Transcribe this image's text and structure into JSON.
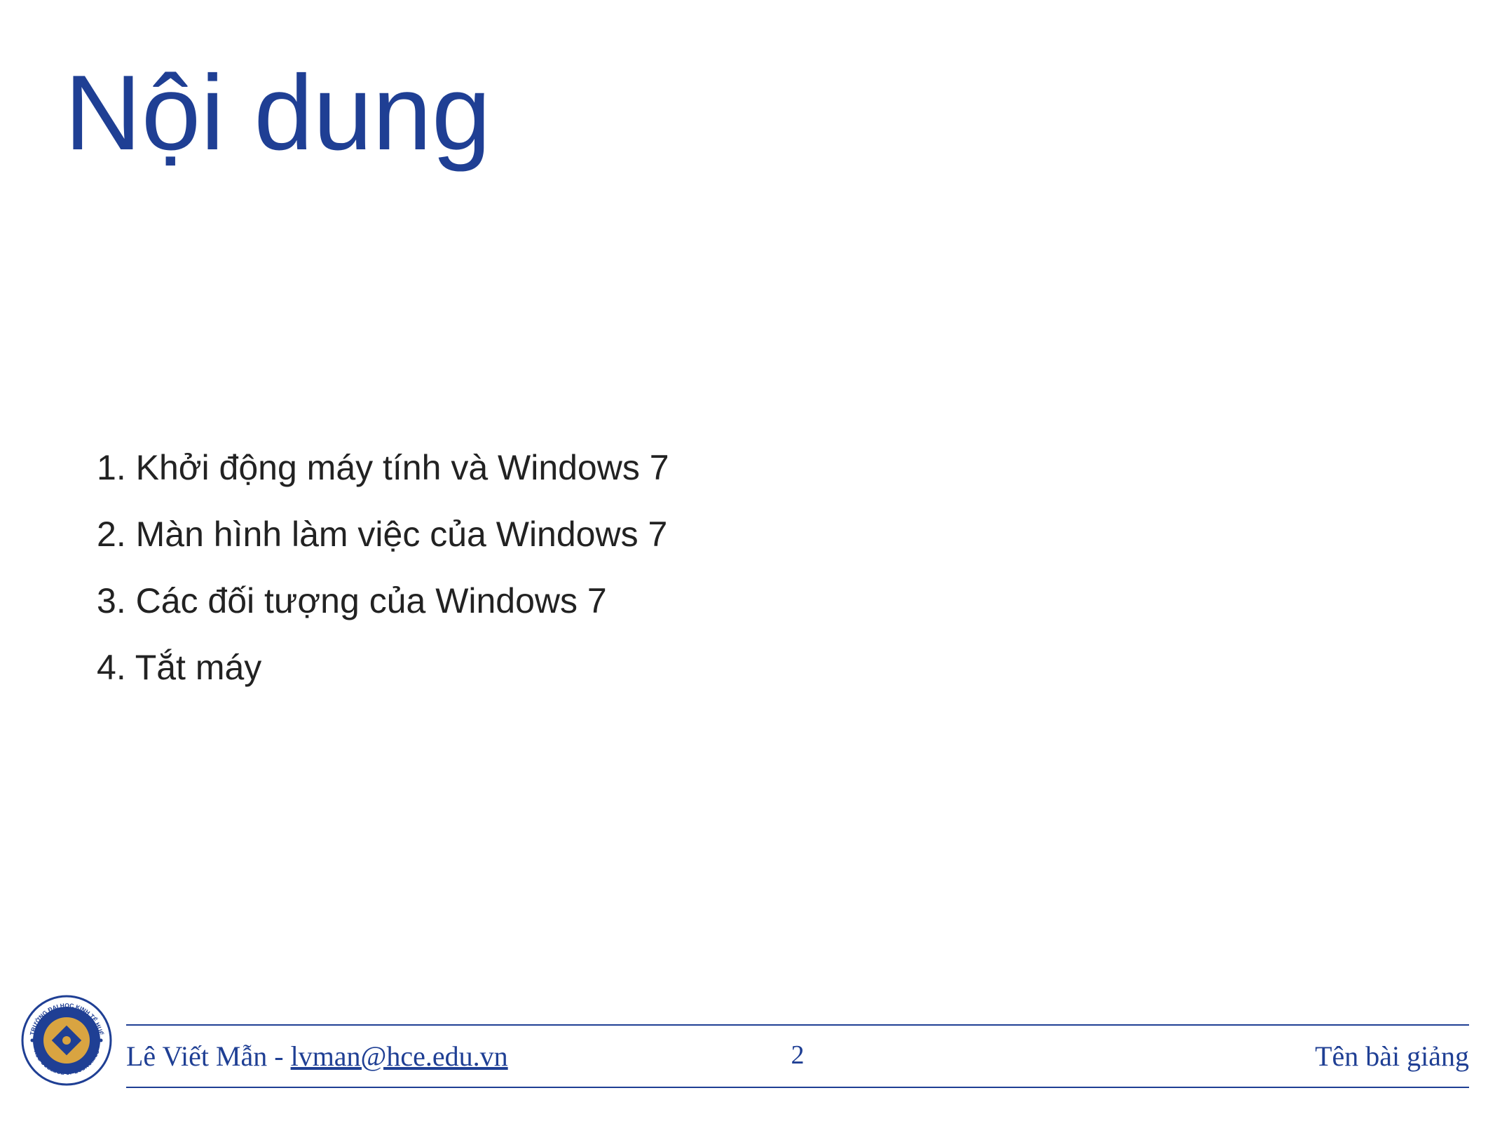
{
  "title": "Nội dung",
  "items": [
    "Khởi động máy tính và Windows 7",
    "Màn hình làm việc của Windows 7",
    "Các đối tượng của Windows 7",
    "Tắt máy"
  ],
  "footer": {
    "author": "Lê Viết Mẫn",
    "separator": " - ",
    "email": "lvman@hce.edu.vn",
    "page": "2",
    "right": "Tên bài giảng"
  },
  "logo": {
    "outer_text_top": "TRƯỜNG ĐẠI HỌC KINH TẾ HUẾ",
    "outer_text_bottom": "HUE COLLEGE OF ECONOMICS"
  },
  "colors": {
    "primary": "#1F3F94",
    "gold": "#D9A441"
  }
}
